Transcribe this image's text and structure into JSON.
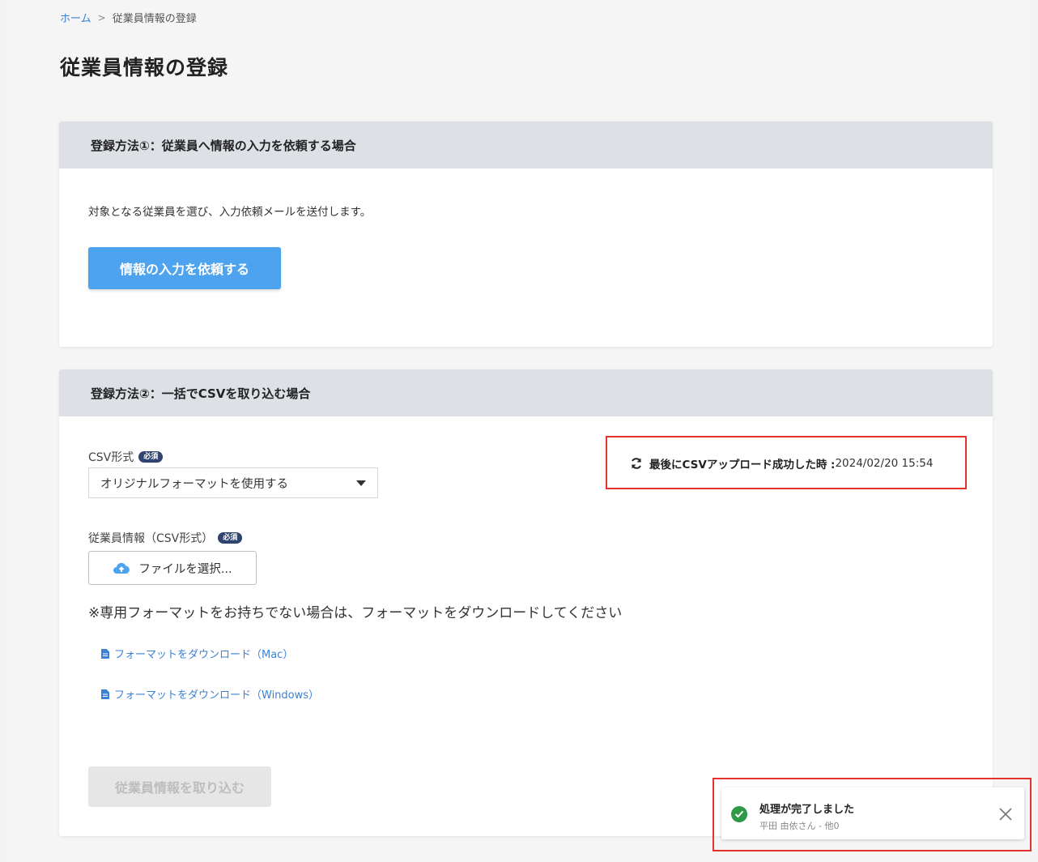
{
  "breadcrumb": {
    "home": "ホーム",
    "separator": ">",
    "current": "従業員情報の登録"
  },
  "page_title": "従業員情報の登録",
  "method1": {
    "header": "登録方法①：従業員へ情報の入力を依頼する場合",
    "description": "対象となる従業員を選び、入力依頼メールを送付します。",
    "button": "情報の入力を依頼する"
  },
  "method2": {
    "header": "登録方法②：一括でCSVを取り込む場合",
    "csv_format_label": "CSV形式",
    "required_badge": "必須",
    "csv_format_selected": "オリジナルフォーマットを使用する",
    "last_upload_label": "最後にCSVアップロード成功した時 :",
    "last_upload_value": "2024/02/20 15:54",
    "file_label": "従業員情報（CSV形式）",
    "file_button": "ファイルを選択...",
    "note": "※専用フォーマットをお持ちでない場合は、フォーマットをダウンロードしてください",
    "download_mac": "フォーマットをダウンロード（Mac）",
    "download_windows": "フォーマットをダウンロード（Windows）",
    "import_button": "従業員情報を取り込む"
  },
  "toast": {
    "title": "処理が完了しました",
    "subtitle": "平田 由依さん - 他0"
  },
  "colors": {
    "primary": "#4ea3ee",
    "link": "#3b82d6",
    "success": "#2e9a46",
    "highlight": "#e5322d"
  }
}
